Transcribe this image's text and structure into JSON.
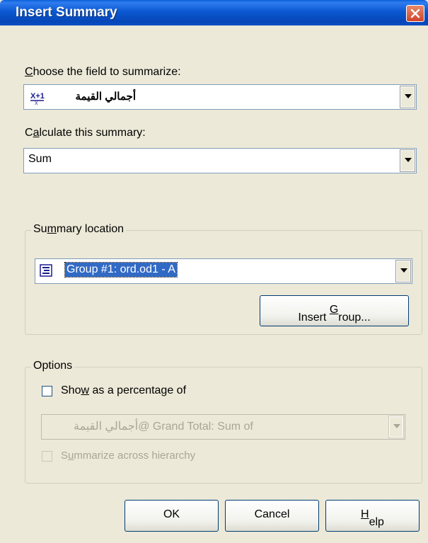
{
  "window": {
    "title": "Insert Summary"
  },
  "field": {
    "label_pre": "",
    "label_key": "C",
    "label_post": "hoose the field to summarize:",
    "value": "أجمالي القيمة",
    "icon": "formula-field-icon",
    "icon_text": "X+1"
  },
  "calc": {
    "label_pre": "C",
    "label_key": "a",
    "label_post": "lculate this summary:",
    "value": "Sum"
  },
  "location": {
    "label_pre": "Su",
    "label_key": "m",
    "label_post": "mary location",
    "value": "Group #1: ord.od1 - A",
    "icon": "group-icon",
    "insert_group_pre": "Insert ",
    "insert_group_key": "G",
    "insert_group_post": "roup..."
  },
  "options": {
    "label": "Options",
    "show_pct_pre": "Sho",
    "show_pct_key": "w",
    "show_pct_post": " as a percentage of",
    "show_pct_checked": false,
    "pct_value": "Grand Total: Sum of @أجمالي القيمة",
    "across_pre": "S",
    "across_key": "u",
    "across_post": "mmarize across hierarchy",
    "across_checked": false
  },
  "buttons": {
    "ok": "OK",
    "cancel": "Cancel",
    "help_key": "H",
    "help_post": "elp"
  },
  "colors": {
    "title_bar": "#0a58d1",
    "face": "#ece9d8",
    "selection": "#316ac5",
    "close": "#d2442a"
  }
}
